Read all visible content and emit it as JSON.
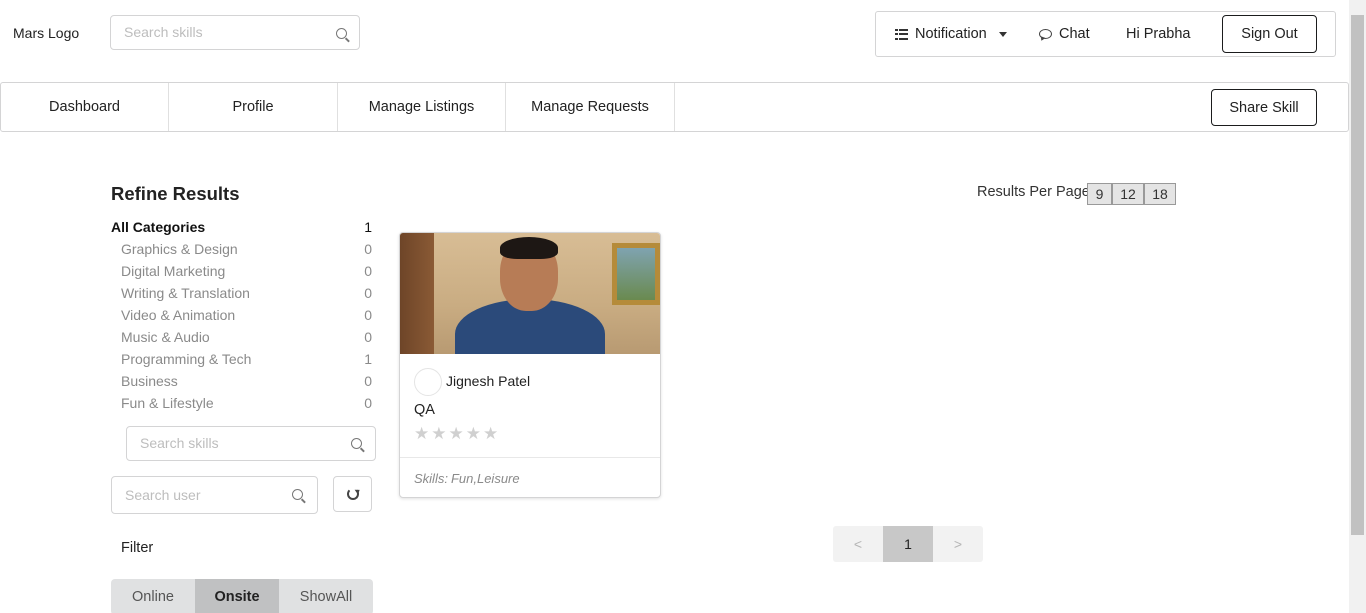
{
  "header": {
    "logo_text": "Mars Logo",
    "search_placeholder": "Search skills",
    "notification_label": "Notification",
    "chat_label": "Chat",
    "greeting": "Hi Prabha",
    "signout_label": "Sign Out"
  },
  "nav": {
    "items": [
      {
        "label": "Dashboard"
      },
      {
        "label": "Profile"
      },
      {
        "label": "Manage Listings"
      },
      {
        "label": "Manage Requests"
      }
    ],
    "share_label": "Share Skill"
  },
  "refine": {
    "title": "Refine Results",
    "categories": [
      {
        "name": "All Categories",
        "count": "1"
      },
      {
        "name": "Graphics & Design",
        "count": "0"
      },
      {
        "name": "Digital Marketing",
        "count": "0"
      },
      {
        "name": "Writing & Translation",
        "count": "0"
      },
      {
        "name": "Video & Animation",
        "count": "0"
      },
      {
        "name": "Music & Audio",
        "count": "0"
      },
      {
        "name": "Programming & Tech",
        "count": "1"
      },
      {
        "name": "Business",
        "count": "0"
      },
      {
        "name": "Fun & Lifestyle",
        "count": "0"
      }
    ],
    "skill_search_placeholder": "Search skills",
    "user_search_placeholder": "Search user",
    "filter_label": "Filter",
    "filter_options": [
      "Online",
      "Onsite",
      "ShowAll"
    ],
    "active_filter": "Onsite"
  },
  "results": {
    "per_page_label": "Results Per Page :",
    "per_page_options": [
      "9",
      "12",
      "18"
    ]
  },
  "card": {
    "seller_name": "Jignesh Patel",
    "title": "QA",
    "rating_stars": 0,
    "rating_max": 5,
    "star_glyph": "★",
    "skills_prefix": "Skills:",
    "skills_value": "Fun,Leisure"
  },
  "pagination": {
    "prev": "<",
    "current": "1",
    "next": ">"
  },
  "colors": {
    "border": "#d4d4d5",
    "muted_text": "#8a8a8a",
    "active_segment": "#c0c1c2"
  }
}
